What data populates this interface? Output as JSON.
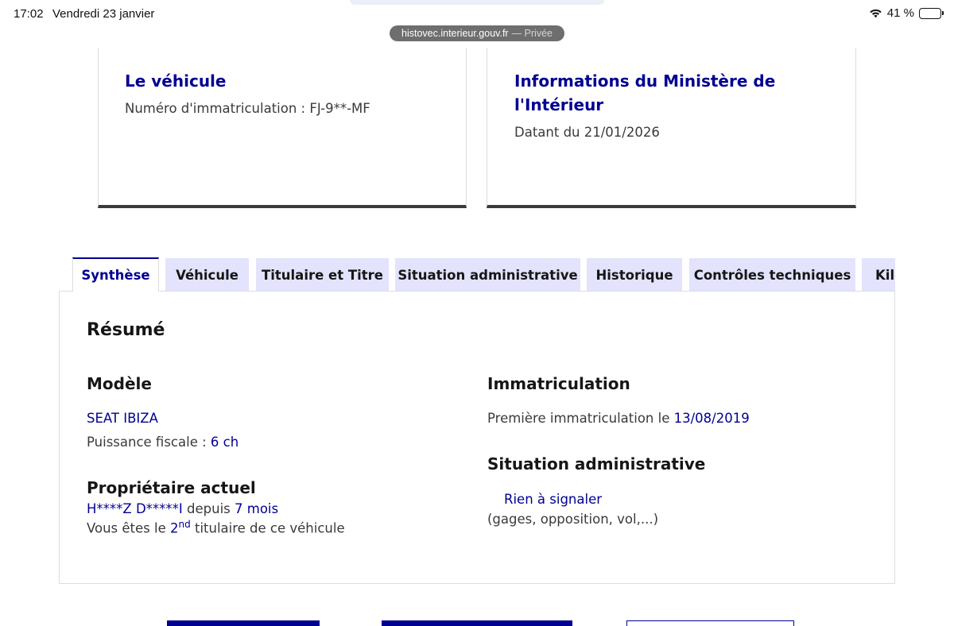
{
  "status_bar": {
    "time": "17:02",
    "date": "Vendredi 23 janvier",
    "battery": "41 %",
    "battery_level": 0.41,
    "wifi_icon": "wifi-icon",
    "battery_icon": "battery-icon"
  },
  "browser": {
    "url": "histovec.interieur.gouv.fr",
    "mode": "— Privée"
  },
  "cards": {
    "vehicle": {
      "title": "Le véhicule",
      "subtitle": "Numéro d'immatriculation : FJ-9**-MF"
    },
    "ministry": {
      "title": "Informations du Ministère de l'Intérieur",
      "subtitle": "Datant du 21/01/2026"
    }
  },
  "tabs": [
    {
      "label": "Synthèse",
      "active": true
    },
    {
      "label": "Véhicule",
      "active": false
    },
    {
      "label": "Titulaire et Titre",
      "active": false
    },
    {
      "label": "Situation administrative",
      "active": false
    },
    {
      "label": "Historique",
      "active": false
    },
    {
      "label": "Contrôles techniques",
      "active": false
    },
    {
      "label": "Kilométrage",
      "active": false
    }
  ],
  "summary": {
    "title": "Résumé",
    "model": {
      "heading": "Modèle",
      "name": "SEAT IBIZA",
      "power_label": "Puissance fiscale : ",
      "power_value": "6 ch"
    },
    "owner": {
      "heading": "Propriétaire actuel",
      "name": "H****Z D*****I",
      "since_label": " depuis ",
      "since_value": "7 mois",
      "rank_prefix": "Vous êtes le ",
      "rank_number": "2",
      "rank_suffix": "nd",
      "rank_tail": " titulaire de ce véhicule"
    },
    "registration": {
      "heading": "Immatriculation",
      "first_label": "Première immatriculation le ",
      "first_date": "13/08/2019"
    },
    "admin": {
      "heading": "Situation administrative",
      "status": "Rien à signaler",
      "detail": "(gages, opposition, vol,...)"
    }
  },
  "colors": {
    "primary_blue": "#000091",
    "tab_background": "#e3e3fd",
    "text": "#3a3a3a"
  }
}
